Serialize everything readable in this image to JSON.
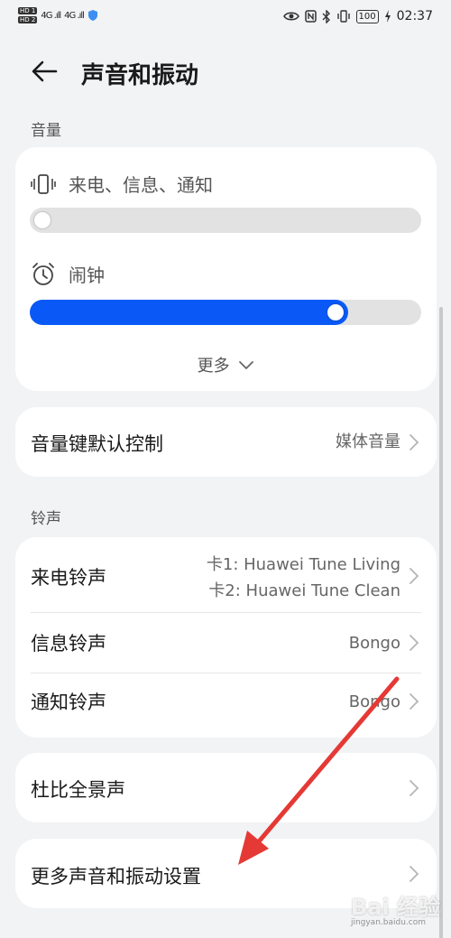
{
  "status_bar": {
    "sim1": "HD 1",
    "sim2": "HD 2",
    "signal1": "4G .ıll",
    "signal2": "4G .ıll",
    "battery": "100",
    "time": "02:37"
  },
  "header": {
    "title": "声音和振动"
  },
  "volume": {
    "section_title": "音量",
    "ringtone_label": "来电、信息、通知",
    "ringtone_level": 0,
    "alarm_label": "闹钟",
    "alarm_level": 0.8,
    "more_label": "更多"
  },
  "volume_key": {
    "label": "音量键默认控制",
    "value": "媒体音量"
  },
  "ringtones": {
    "section_title": "铃声",
    "incoming_label": "来电铃声",
    "incoming_value_1": "卡1: Huawei Tune Living",
    "incoming_value_2": "卡2: Huawei Tune Clean",
    "message_label": "信息铃声",
    "message_value": "Bongo",
    "notification_label": "通知铃声",
    "notification_value": "Bongo"
  },
  "dolby": {
    "label": "杜比全景声"
  },
  "more_settings": {
    "label": "更多声音和振动设置"
  },
  "watermark": {
    "text": "Bai 经验",
    "sub": "jingyan.baidu.com"
  },
  "colors": {
    "accent": "#0a59f7",
    "annotation_arrow": "#e53935"
  }
}
